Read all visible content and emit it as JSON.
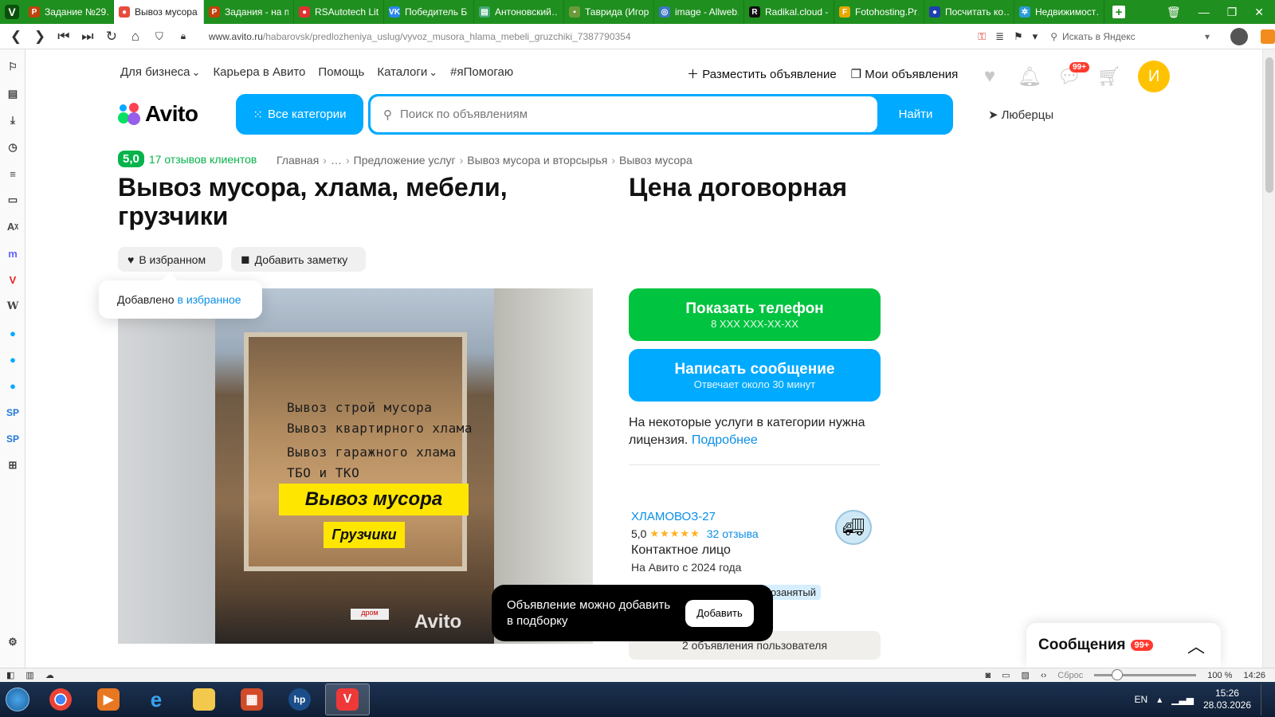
{
  "browser": {
    "tabs": [
      {
        "label": "Задание №29…",
        "color": "#c2410c",
        "glyph": "P",
        "active": false
      },
      {
        "label": "Вывоз мусора…",
        "color": "#e74c3c",
        "glyph": "●",
        "active": true
      },
      {
        "label": "Задания - на п…",
        "color": "#c2410c",
        "glyph": "P",
        "active": false
      },
      {
        "label": "RSAutotech Lit…",
        "color": "#d33",
        "glyph": "●",
        "active": false
      },
      {
        "label": "Победитель Б…",
        "color": "#2787f5",
        "glyph": "VK",
        "active": false
      },
      {
        "label": "Антоновский…",
        "color": "#4a7",
        "glyph": "▤",
        "active": false
      },
      {
        "label": "Таврида (Игор…",
        "color": "#6a9a3a",
        "glyph": "▪",
        "active": false
      },
      {
        "label": "image - Allweb…",
        "color": "#3a78c2",
        "glyph": "◎",
        "active": false
      },
      {
        "label": "Radikal.cloud -…",
        "color": "#111",
        "glyph": "R",
        "active": false
      },
      {
        "label": "Fotohosting.Pr…",
        "color": "#e8a800",
        "glyph": "F",
        "active": false
      },
      {
        "label": "Посчитать ко…",
        "color": "#1e40af",
        "glyph": "●",
        "active": false
      },
      {
        "label": "Недвижимост…",
        "color": "#2a9dd8",
        "glyph": "✲",
        "active": false
      }
    ],
    "window_controls": [
      "🗑",
      "—",
      "❐",
      "✕"
    ],
    "url_host": "www.avito.ru",
    "url_path": "/habarovsk/predlozheniya_uslug/vyvoz_musora_hlama_mebeli_gruzchiki_7387790354",
    "yandex_search_placeholder": "Искать в Яндекс",
    "status": {
      "reset_label": "Сброс",
      "zoom": "100 %",
      "time": "14:26"
    }
  },
  "site": {
    "topnav": [
      {
        "label": "Для бизнеса",
        "dropdown": true
      },
      {
        "label": "Карьера в Авито",
        "dropdown": false
      },
      {
        "label": "Помощь",
        "dropdown": false
      },
      {
        "label": "Каталоги",
        "dropdown": true
      },
      {
        "label": "#яПомогаю",
        "dropdown": false
      }
    ],
    "post_ad": "Разместить объявление",
    "my_ads": "Мои объявления",
    "messages_badge": "99+",
    "avatar_letter": "И",
    "logo_text": "Avito",
    "all_categories": "Все категории",
    "search_placeholder": "Поиск по объявлениям",
    "search_button": "Найти",
    "location": "Люберцы",
    "accent": "#00aaff",
    "green": "#04b34a"
  },
  "listing": {
    "rating_score": "5,0",
    "rating_reviews": "17 отзывов клиентов",
    "breadcrumbs": [
      "Главная",
      "…",
      "Предложение услуг",
      "Вывоз мусора и вторсырья",
      "Вывоз мусора"
    ],
    "title": "Вывоз мусора, хлама, мебели, грузчики",
    "price": "Цена договорная",
    "favorite_label": "В избранном",
    "note_label": "Добавить заметку",
    "favorite_toast_text": "Добавлено",
    "favorite_toast_link": "в избранное",
    "photo_lines": [
      "Вывоз строй мусора",
      "Вывоз квартирного хлама",
      "Вывоз гаражного хлама",
      "ТБО и ТКО"
    ],
    "photo_banner": "Вывоз мусора",
    "photo_banner2": "Грузчики",
    "photo_watermark": "Avito",
    "photo_plate": "дром",
    "phone_button": "Показать телефон",
    "phone_masked": "8 XXX XXX-XX-XX",
    "message_button": "Написать сообщение",
    "message_sub": "Отвечает около 30 минут",
    "license_text": "На некоторые услуги в категории нужна лицензия.",
    "license_link": "Подробнее",
    "seller": {
      "name": "ХЛАМОВОЗ-27",
      "score": "5,0",
      "stars": "★★★★★",
      "reviews": "32 отзыва",
      "contact": "Контактное лицо",
      "since": "На Авито с 2024 года",
      "self_employed": "мозанятый",
      "ads_count": "2 объявления пользователя"
    },
    "collection_toast": "Объявление можно добавить в подборку",
    "collection_add": "Добавить",
    "messages_panel": "Сообщения",
    "messages_panel_badge": "99+"
  },
  "taskbar": {
    "lang": "EN",
    "time": "15:26",
    "date": "28.03.2026"
  }
}
